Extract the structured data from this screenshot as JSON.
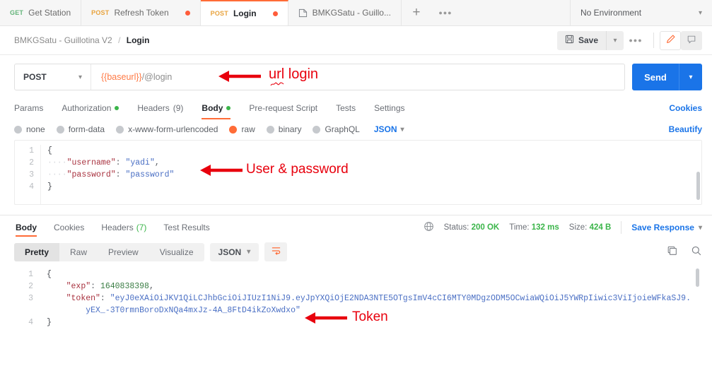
{
  "tabstrip": {
    "tabs": [
      {
        "method": "GET",
        "name": "Get Station",
        "unsaved": false
      },
      {
        "method": "POST",
        "name": "Refresh Token",
        "unsaved": true
      },
      {
        "method": "POST",
        "name": "Login",
        "unsaved": true
      },
      {
        "method": "",
        "name": "BMKGSatu - Guillo...",
        "unsaved": false
      }
    ],
    "new_tab_label": "+",
    "more_label": "●●●",
    "environment": "No Environment"
  },
  "header": {
    "breadcrumb_collection": "BMKGSatu - Guillotina V2",
    "breadcrumb_separator": "/",
    "breadcrumb_current": "Login",
    "save_label": "Save",
    "more_label": "●●●"
  },
  "url_bar": {
    "method": "POST",
    "url_variable": "{{baseurl}}",
    "url_path": "/@login",
    "send_label": "Send"
  },
  "request_tabs": {
    "items": [
      {
        "label": "Params",
        "badge": "",
        "dot": false,
        "active": false
      },
      {
        "label": "Authorization",
        "badge": "",
        "dot": true,
        "active": false
      },
      {
        "label": "Headers",
        "badge": "(9)",
        "dot": false,
        "active": false
      },
      {
        "label": "Body",
        "badge": "",
        "dot": true,
        "active": true
      },
      {
        "label": "Pre-request Script",
        "badge": "",
        "dot": false,
        "active": false
      },
      {
        "label": "Tests",
        "badge": "",
        "dot": false,
        "active": false
      },
      {
        "label": "Settings",
        "badge": "",
        "dot": false,
        "active": false
      }
    ],
    "cookies_label": "Cookies"
  },
  "body_type": {
    "options": [
      {
        "label": "none",
        "selected": false
      },
      {
        "label": "form-data",
        "selected": false
      },
      {
        "label": "x-www-form-urlencoded",
        "selected": false
      },
      {
        "label": "raw",
        "selected": true
      },
      {
        "label": "binary",
        "selected": false
      },
      {
        "label": "GraphQL",
        "selected": false
      }
    ],
    "format": "JSON",
    "beautify_label": "Beautify"
  },
  "request_body": {
    "line_numbers": [
      "1",
      "2",
      "3",
      "4"
    ],
    "lines": [
      "{",
      "    \"username\": \"yadi\",",
      "    \"password\": \"password\"",
      "}"
    ],
    "fields": {
      "username_key": "\"username\"",
      "username_value": "\"yadi\"",
      "password_key": "\"password\"",
      "password_value": "\"password\""
    }
  },
  "response_tabs": {
    "items": [
      {
        "label": "Body",
        "badge": "",
        "active": true
      },
      {
        "label": "Cookies",
        "badge": "",
        "active": false
      },
      {
        "label": "Headers",
        "badge": "(7)",
        "active": false
      },
      {
        "label": "Test Results",
        "badge": "",
        "active": false
      }
    ],
    "status_label": "Status:",
    "status_value": "200 OK",
    "time_label": "Time:",
    "time_value": "132 ms",
    "size_label": "Size:",
    "size_value": "424 B",
    "save_response_label": "Save Response"
  },
  "response_toolbar": {
    "views": [
      {
        "label": "Pretty",
        "active": true
      },
      {
        "label": "Raw",
        "active": false
      },
      {
        "label": "Preview",
        "active": false
      },
      {
        "label": "Visualize",
        "active": false
      }
    ],
    "format": "JSON"
  },
  "response_body": {
    "line_numbers": [
      "1",
      "2",
      "3",
      "4"
    ],
    "exp_key": "\"exp\"",
    "exp_value": "1640838398",
    "token_key": "\"token\"",
    "token_value_line1": "\"eyJ0eXAiOiJKV1QiLCJhbGciOiJIUzI1NiJ9.eyJpYXQiOjE2NDA3NTE5OTgsImV4cCI6MTY0MDgzODM5OCwiaWQiOiJ5YWRpIiwic3ViIjoieWFkaSJ9.",
    "token_value_line2": "yEX_-3T0rmnBoroDxNQa4mxJz-4A_8FtD4ikZoXwdxo\""
  },
  "annotations": [
    {
      "text": "url login",
      "color": "#e8000d"
    },
    {
      "text": "User & password",
      "color": "#e8000d"
    },
    {
      "text": "Token",
      "color": "#e8000d"
    }
  ],
  "colors": {
    "accent_orange": "#ff6c37",
    "send_blue": "#1a74e8",
    "link_blue": "#1a74e8",
    "success_green": "#3bb54a",
    "annotation_red": "#e8000d",
    "get_green": "#64b47a",
    "post_orange": "#e8a33d"
  }
}
